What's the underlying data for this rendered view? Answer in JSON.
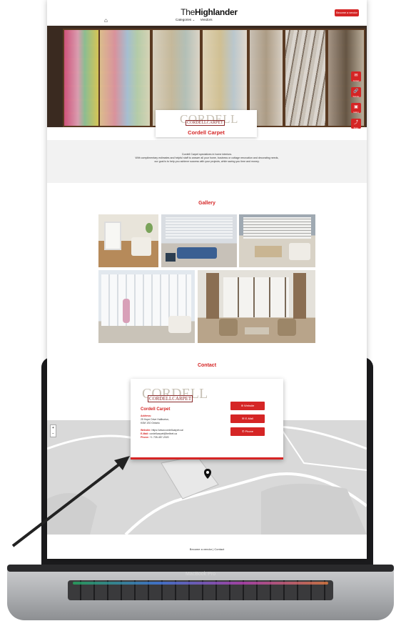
{
  "header": {
    "logo_light": "The",
    "logo_bold": "Highlander",
    "nav_categories": "Categories",
    "nav_vendors": "Vendors",
    "cta_label": "Become a vendor"
  },
  "side_actions": [
    "Contact",
    "Website",
    "Gallery",
    "Share"
  ],
  "company": {
    "logo_big": "CORDELL",
    "logo_small": "CORDELLCARPET",
    "name": "Cordell Carpet",
    "about": [
      "Cordell Carpet specializes in home interiors.",
      "With complimentary estimates and helpful staff to answer all your home, business or cottage renovation and decorating needs,",
      "our goal is to help you achieve success with your projects, while saving you time and money."
    ]
  },
  "gallery": {
    "title": "Gallery"
  },
  "contact": {
    "title": "Contact",
    "name": "Cordell Carpet",
    "address_label": "Address:",
    "address_line1": "25 Hope Drive Haliburton,",
    "address_line2": "K0M 1S0 Ontario",
    "website_label": "Website:",
    "website": "https://www.cordellcarpet.ca/",
    "email_label": "E-Mail:",
    "email": "cordellcarpet@bellnet.ca",
    "phone_label": "Phone:",
    "phone": "+1 705-457-2020",
    "buttons": [
      "Website",
      "E-Mail",
      "Phone"
    ]
  },
  "map": {
    "zoom_in": "+",
    "zoom_out": "−"
  },
  "footer": {
    "text": "Become a vendor | Contact"
  },
  "laptop": {
    "model": "MacBook Pro"
  },
  "colors": {
    "accent": "#d52525",
    "laptop": "#1b1b1d"
  }
}
